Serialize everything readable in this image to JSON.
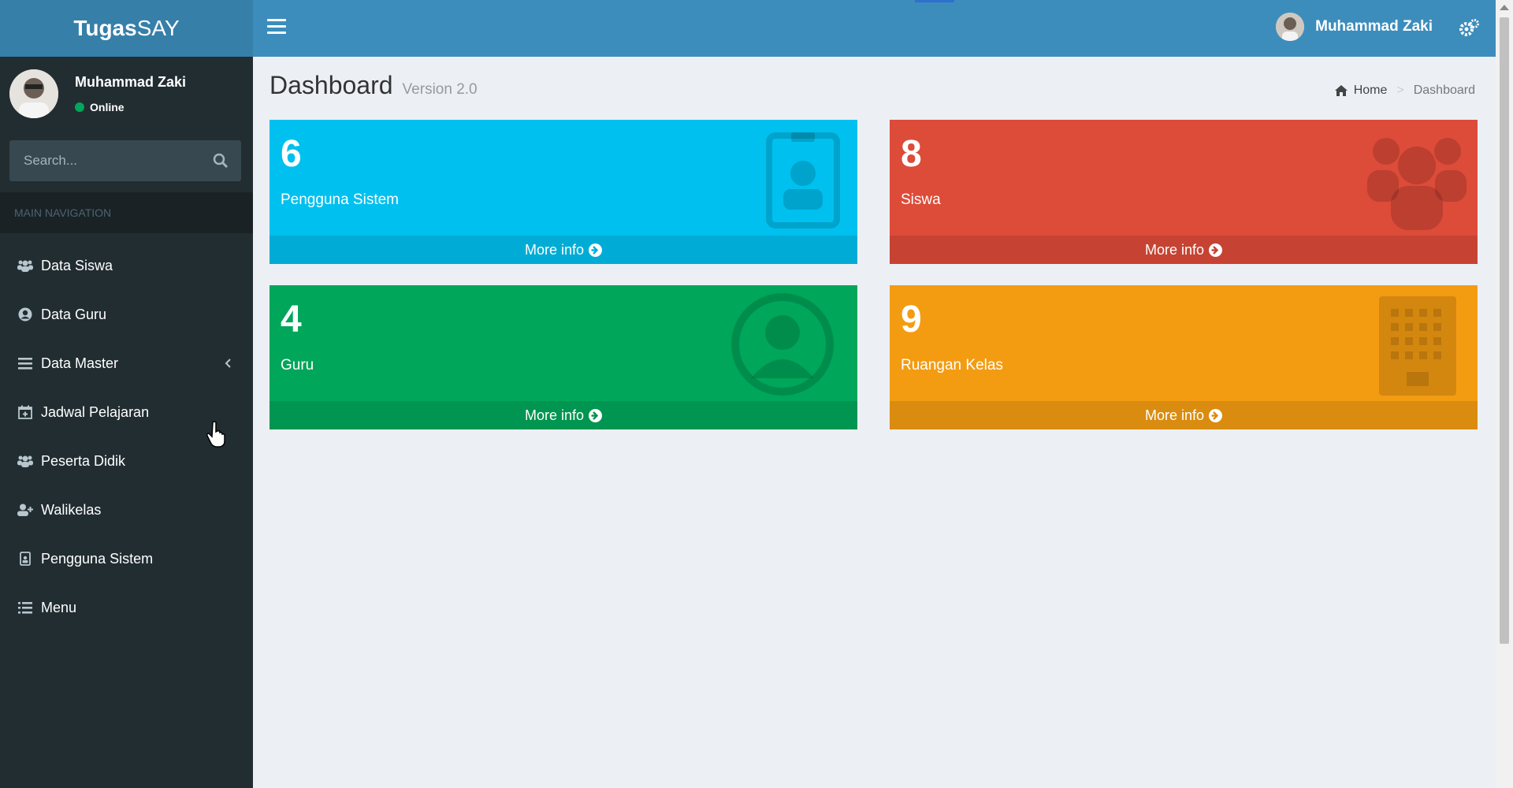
{
  "app": {
    "logo_bold": "Tugas",
    "logo_light": "SAY"
  },
  "header": {
    "user_name": "Muhammad Zaki",
    "toggle_icon": "hamburger-icon",
    "settings_icon": "gears-icon",
    "accent_color": "#3c8dbc"
  },
  "sidebar": {
    "user_name": "Muhammad Zaki",
    "status": "Online",
    "status_color": "#00a65a",
    "search_placeholder": "Search...",
    "nav_header": "MAIN NAVIGATION",
    "items": [
      {
        "label": "Data Siswa",
        "icon": "users-icon"
      },
      {
        "label": "Data Guru",
        "icon": "user-circle-icon"
      },
      {
        "label": "Data Master",
        "icon": "bars-icon",
        "has_submenu": true
      },
      {
        "label": "Jadwal Pelajaran",
        "icon": "calendar-plus-icon"
      },
      {
        "label": "Peserta Didik",
        "icon": "users-icon"
      },
      {
        "label": "Walikelas",
        "icon": "user-plus-icon"
      },
      {
        "label": "Pengguna Sistem",
        "icon": "id-badge-icon"
      },
      {
        "label": "Menu",
        "icon": "list-icon"
      }
    ]
  },
  "content": {
    "title": "Dashboard",
    "subtitle": "Version 2.0",
    "breadcrumb": {
      "home": "Home",
      "current": "Dashboard"
    },
    "boxes": [
      {
        "value": "6",
        "label": "Pengguna Sistem",
        "more": "More info",
        "color": "#00c0ef",
        "icon": "id-badge-icon"
      },
      {
        "value": "8",
        "label": "Siswa",
        "more": "More info",
        "color": "#dd4b39",
        "icon": "users-icon"
      },
      {
        "value": "4",
        "label": "Guru",
        "more": "More info",
        "color": "#00a65a",
        "icon": "user-circle-icon"
      },
      {
        "value": "9",
        "label": "Ruangan Kelas",
        "more": "More info",
        "color": "#f39c12",
        "icon": "building-icon"
      }
    ]
  }
}
